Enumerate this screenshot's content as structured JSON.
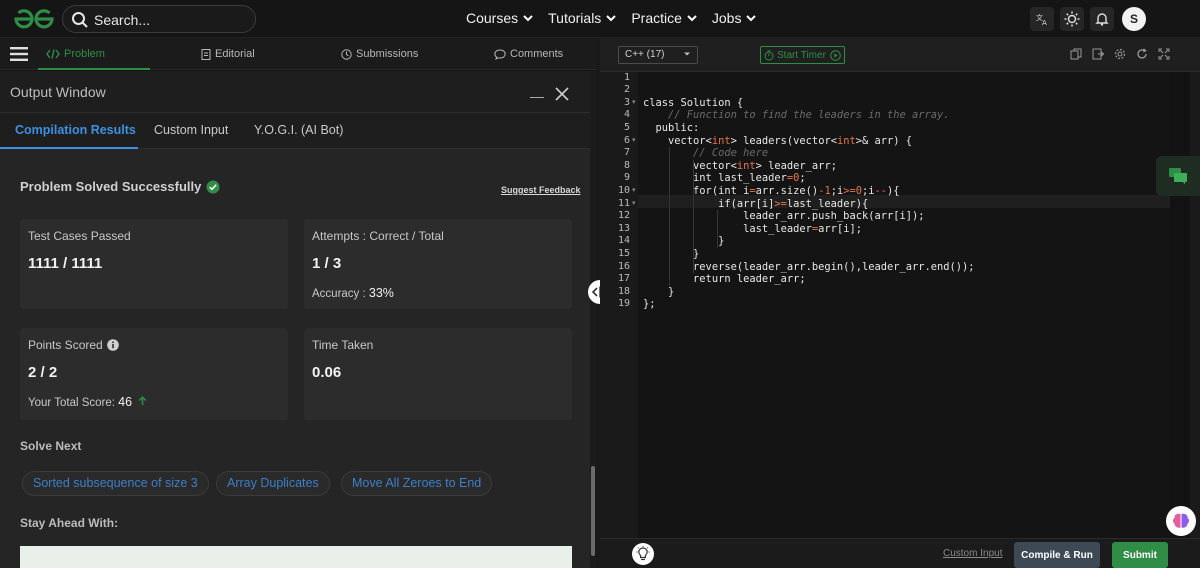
{
  "nav": {
    "search_placeholder": "Search...",
    "links": [
      "Courses",
      "Tutorials",
      "Practice",
      "Jobs"
    ],
    "avatar_letter": "S"
  },
  "tabs": {
    "problem": "Problem",
    "editorial": "Editorial",
    "submissions": "Submissions",
    "comments": "Comments"
  },
  "output": {
    "title": "Output Window",
    "tabs": [
      "Compilation Results",
      "Custom Input",
      "Y.O.G.I. (AI Bot)"
    ],
    "status": "Problem Solved Successfully",
    "feedback": "Suggest Feedback",
    "test_cases_label": "Test Cases Passed",
    "test_cases_value": "1111 / 1111",
    "attempts_label": "Attempts : Correct / Total",
    "attempts_value": "1 / 3",
    "accuracy_label": "Accuracy : ",
    "accuracy_value": "33%",
    "points_label": "Points Scored",
    "points_value": "2 / 2",
    "total_score_label": "Your Total Score: ",
    "total_score_value": "46",
    "time_label": "Time Taken",
    "time_value": "0.06",
    "solve_next": "Solve Next",
    "chips": [
      "Sorted subsequence of size 3",
      "Array Duplicates",
      "Move All Zeroes to End"
    ],
    "stay_ahead": "Stay Ahead With:"
  },
  "editor": {
    "language": "C++ (17)",
    "timer": "Start Timer",
    "lines": [
      "",
      "",
      "class Solution {",
      "    // Function to find the leaders in the array.",
      "  public:",
      "    vector<int> leaders(vector<int>& arr) {",
      "        // Code here",
      "        vector<int> leader_arr;",
      "        int last_leader=0;",
      "        for(int i=arr.size()-1;i>=0;i--){",
      "            if(arr[i]>=last_leader){",
      "                leader_arr.push_back(arr[i]);",
      "                last_leader=arr[i];",
      "            }",
      "        }",
      "        reverse(leader_arr.begin(),leader_arr.end());",
      "        return leader_arr;",
      "    }",
      "};"
    ],
    "custom_input": "Custom Input",
    "compile_run": "Compile & Run",
    "submit": "Submit"
  },
  "colors": {
    "brand_green": "#2f8d46",
    "link_blue": "#3d8fe0",
    "keyword_orange": "#e8754a",
    "comment_gray": "#6a6a6a"
  }
}
